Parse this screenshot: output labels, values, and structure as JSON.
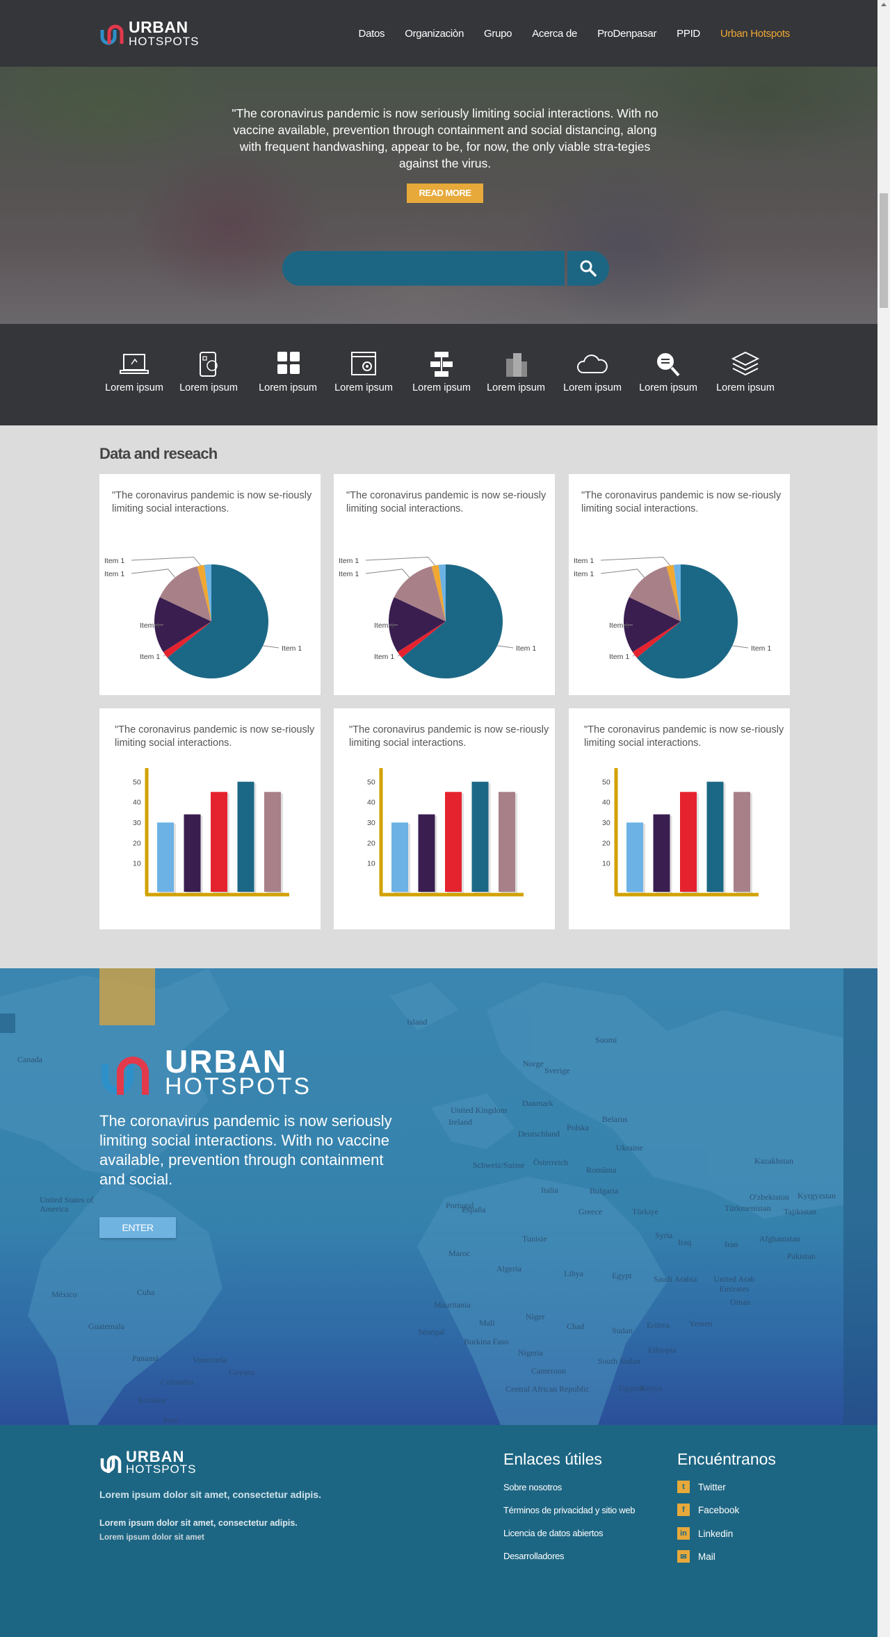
{
  "brand": {
    "name_top": "URBAN",
    "name_bottom": "HOTSPOTS"
  },
  "nav": {
    "items": [
      {
        "label": "Datos"
      },
      {
        "label": "Organizaciòn"
      },
      {
        "label": "Grupo"
      },
      {
        "label": "Acerca de"
      },
      {
        "label": "ProDenpasar"
      },
      {
        "label": "PPID"
      },
      {
        "label": "Urban Hotspots",
        "active": true
      }
    ]
  },
  "hero": {
    "quote": "\"The coronavirus pandemic is now seriously limiting social interactions. With no vaccine available, prevention through containment and social distancing, along with frequent handwashing, appear to be, for now, the only viable stra-tegies against the virus.",
    "read_more": "READ MORE",
    "search_placeholder": ""
  },
  "categories": [
    {
      "label": "Lorem ipsum",
      "icon": "laptop-icon"
    },
    {
      "label": "Lorem ipsum",
      "icon": "tablet-apps-icon"
    },
    {
      "label": "Lorem ipsum",
      "icon": "grid-icon"
    },
    {
      "label": "Lorem ipsum",
      "icon": "browser-settings-icon"
    },
    {
      "label": "Lorem ipsum",
      "icon": "network-server-icon"
    },
    {
      "label": "Lorem ipsum",
      "icon": "buildings-icon"
    },
    {
      "label": "Lorem ipsum",
      "icon": "cloud-icon"
    },
    {
      "label": "Lorem ipsum",
      "icon": "search-data-icon"
    },
    {
      "label": "Lorem ipsum",
      "icon": "layers-icon"
    }
  ],
  "data_section": {
    "title": "Data and reseach",
    "card_text": "\"The coronavirus pandemic is now se-riously limiting social interactions."
  },
  "chart_data": [
    {
      "type": "pie",
      "labels": [
        "Item 1",
        "Item 1",
        "Item 1",
        "Item 1",
        "Item 1",
        "Item 1"
      ],
      "values": [
        64,
        2,
        16,
        14,
        2,
        2
      ],
      "colors": [
        "#1b6886",
        "#e5232f",
        "#3a1e50",
        "#a88088",
        "#f0a833",
        "#6cb2e4"
      ]
    },
    {
      "type": "pie",
      "labels": [
        "Item 1",
        "Item 1",
        "Item 1",
        "Item 1",
        "Item 1",
        "Item 1"
      ],
      "values": [
        64,
        2,
        16,
        14,
        2,
        2
      ],
      "colors": [
        "#1b6886",
        "#e5232f",
        "#3a1e50",
        "#a88088",
        "#f0a833",
        "#6cb2e4"
      ]
    },
    {
      "type": "pie",
      "labels": [
        "Item 1",
        "Item 1",
        "Item 1",
        "Item 1",
        "Item 1",
        "Item 1"
      ],
      "values": [
        64,
        2,
        16,
        14,
        2,
        2
      ],
      "colors": [
        "#1b6886",
        "#e5232f",
        "#3a1e50",
        "#a88088",
        "#f0a833",
        "#6cb2e4"
      ]
    },
    {
      "type": "bar",
      "values": [
        34,
        38,
        49,
        54,
        49
      ],
      "colors": [
        "#6cb2e4",
        "#3a1e50",
        "#e5232f",
        "#1b6886",
        "#a88088"
      ],
      "yticks": [
        10,
        20,
        30,
        40,
        50
      ],
      "ylim": [
        0,
        60
      ]
    },
    {
      "type": "bar",
      "values": [
        34,
        38,
        49,
        54,
        49
      ],
      "colors": [
        "#6cb2e4",
        "#3a1e50",
        "#e5232f",
        "#1b6886",
        "#a88088"
      ],
      "yticks": [
        10,
        20,
        30,
        40,
        50
      ],
      "ylim": [
        0,
        60
      ]
    },
    {
      "type": "bar",
      "values": [
        34,
        38,
        49,
        54,
        49
      ],
      "colors": [
        "#6cb2e4",
        "#3a1e50",
        "#e5232f",
        "#1b6886",
        "#a88088"
      ],
      "yticks": [
        10,
        20,
        30,
        40,
        50
      ],
      "ylim": [
        0,
        60
      ]
    }
  ],
  "map_section": {
    "text": "The coronavirus pandemic is now seriously limiting social interactions. With no vaccine available, prevention through containment and social.",
    "enter": "ENTER",
    "labels": [
      "Island",
      "Suomi",
      "Norge",
      "Sverige",
      "Canada",
      "United Kingdom",
      "Ireland",
      "Danmark",
      "Belarus",
      "Deutschland",
      "Polska",
      "Ukraine",
      "Kazakhstan",
      "Schweiz/Suisse",
      "Österreich",
      "România",
      "Italia",
      "Bulgaria",
      "O'zbekiston",
      "Kyrgyzstan",
      "United States of America",
      "Portugal",
      "España",
      "Greece",
      "Türkiye",
      "Türkmenistan",
      "Tajikistan",
      "Tunisie",
      "Syria",
      "Afghanistan",
      "Maroc",
      "Iraq",
      "Iran",
      "Pakistan",
      "Algeria",
      "Libya",
      "Egypt",
      "Saudi Arabia",
      "United Arab Emirates",
      "Oman",
      "México",
      "Cuba",
      "Mauritania",
      "Mali",
      "Niger",
      "Chad",
      "Sudan",
      "Eritrea",
      "Yemen",
      "Guatemala",
      "Sénégal",
      "Burkina Faso",
      "Nigeria",
      "Ethiopia",
      "Venezuela",
      "Colombia",
      "Guyana",
      "Panamá",
      "Cameroon",
      "South Sudan",
      "Central African Republic",
      "Uganda",
      "Kenya",
      "Ecuador",
      "Perú"
    ]
  },
  "footer": {
    "line1": "Lorem ipsum dolor sit amet, consectetur adipis.",
    "line2": "Lorem ipsum dolor sit amet, consectetur adipis.",
    "line3": "Lorem ipsum dolor sit amet",
    "links_title": "Enlaces útiles",
    "links": [
      "Sobre nosotros",
      "Términos de privacidad y sitio web",
      "Licencia de datos abiertos",
      "Desarrolladores"
    ],
    "social_title": "Encuéntranos",
    "social": [
      {
        "label": "Twitter",
        "icon": "twitter-icon"
      },
      {
        "label": "Facebook",
        "icon": "facebook-icon"
      },
      {
        "label": "Linkedin",
        "icon": "linkedin-icon"
      },
      {
        "label": "Mail",
        "icon": "mail-icon"
      }
    ]
  },
  "colors": {
    "nav_bg": "#35363a",
    "accent": "#f0a833",
    "teal": "#1d6683",
    "button_blue": "#6fb3e0"
  }
}
